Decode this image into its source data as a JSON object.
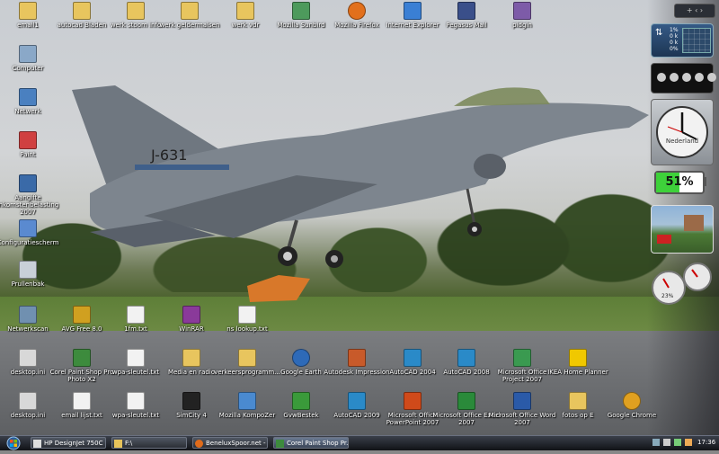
{
  "desktop_icons": [
    {
      "label": "email1",
      "icon": "folder-icon"
    },
    {
      "label": "autocad Bladen",
      "icon": "folder-icon"
    },
    {
      "label": "werk stoom info",
      "icon": "folder-icon"
    },
    {
      "label": "werk geldermalsen",
      "icon": "folder-icon"
    },
    {
      "label": "werk vdr",
      "icon": "folder-icon"
    },
    {
      "label": "Mozilla Sunbird",
      "icon": "sunbird-icon"
    },
    {
      "label": "Mozilla Firefox",
      "icon": "firefox-icon"
    },
    {
      "label": "Internet Explorer",
      "icon": "ie-icon"
    },
    {
      "label": "Pegasus Mail",
      "icon": "pegasus-icon"
    },
    {
      "label": "pidgin",
      "icon": "pidgin-icon"
    },
    {
      "label": "Computer",
      "icon": "computer-icon"
    },
    {
      "label": "Netwerk",
      "icon": "network-icon"
    },
    {
      "label": "Paint",
      "icon": "paint-icon"
    },
    {
      "label": "Aangifte inkomstenbelasting 2007",
      "icon": "tax-icon"
    },
    {
      "label": "Configuratiescherm",
      "icon": "control-panel-icon"
    },
    {
      "label": "Prullenbak",
      "icon": "recycle-bin-icon"
    },
    {
      "label": "Netwerkscan",
      "icon": "network-scan-icon"
    },
    {
      "label": "AVG Free 8.0",
      "icon": "avg-icon"
    },
    {
      "label": "1fm.txt",
      "icon": "text-file-icon"
    },
    {
      "label": "WinRAR",
      "icon": "winrar-icon"
    },
    {
      "label": "ns lookup.txt",
      "icon": "text-file-icon"
    },
    {
      "label": "desktop.ini",
      "icon": "ini-file-icon"
    },
    {
      "label": "Corel Paint Shop Pro Photo X2",
      "icon": "corel-icon"
    },
    {
      "label": "wpa-sleutel.txt",
      "icon": "text-file-icon"
    },
    {
      "label": "Media en radio",
      "icon": "folder-icon"
    },
    {
      "label": "verkeersprogramm...",
      "icon": "folder-icon"
    },
    {
      "label": "Google Earth",
      "icon": "google-earth-icon"
    },
    {
      "label": "Autodesk Impression",
      "icon": "autodesk-impression-icon"
    },
    {
      "label": "AutoCAD 2004",
      "icon": "autocad-icon"
    },
    {
      "label": "AutoCAD 2008",
      "icon": "autocad-icon"
    },
    {
      "label": "Microsoft Office Project 2007",
      "icon": "ms-project-icon"
    },
    {
      "label": "IKEA Home Planner",
      "icon": "ikea-icon"
    },
    {
      "label": "desktop.ini",
      "icon": "ini-file-icon"
    },
    {
      "label": "email lijst.txt",
      "icon": "text-file-icon"
    },
    {
      "label": "wpa-sleutel.txt",
      "icon": "text-file-icon"
    },
    {
      "label": "SimCity 4",
      "icon": "simcity-icon"
    },
    {
      "label": "Mozilla KompoZer",
      "icon": "kompozer-icon"
    },
    {
      "label": "GvwBestek",
      "icon": "gvw-icon"
    },
    {
      "label": "AutoCAD 2009",
      "icon": "autocad-icon"
    },
    {
      "label": "Microsoft Office PowerPoint 2007",
      "icon": "powerpoint-icon"
    },
    {
      "label": "Microsoft Office Excel 2007",
      "icon": "excel-icon"
    },
    {
      "label": "Microsoft Office Word 2007",
      "icon": "word-icon"
    },
    {
      "label": "fotos op E",
      "icon": "folder-icon"
    },
    {
      "label": "Google Chrome",
      "icon": "chrome-icon"
    }
  ],
  "wallpaper": {
    "tail_code": "J-631"
  },
  "sidebar": {
    "controls": "+ ‹ ›",
    "meter": {
      "cpu": "1%",
      "ram": "0 k",
      "net1": "0 k",
      "pct": "0%"
    },
    "clock_brand": "Nederland",
    "battery_value": "51%",
    "gauge_label": "23%"
  },
  "taskbar": {
    "tasks": [
      {
        "label": "HP DesignJet 750C",
        "icon": "printer-icon"
      },
      {
        "label": "F:\\",
        "icon": "folder-icon"
      },
      {
        "label": "BeneluxSpoor.net - ...",
        "icon": "firefox-icon"
      },
      {
        "label": "Corel Paint Shop Pr...",
        "icon": "corel-icon"
      }
    ],
    "clock": "17:36"
  },
  "colors": {
    "battery": "#3ed13a",
    "taskbar": "#1b1e24"
  }
}
